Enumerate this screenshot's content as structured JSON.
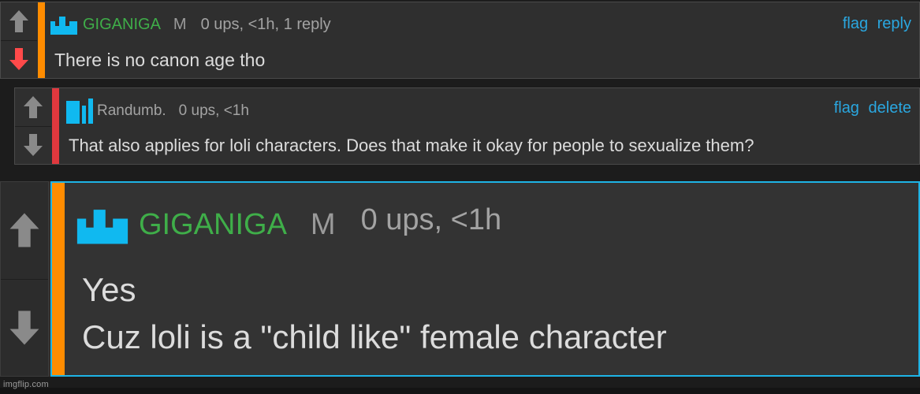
{
  "comments": [
    {
      "username": "GIGANIGA",
      "badge": "M",
      "meta": "0 ups, <1h, 1 reply",
      "actions": [
        "flag",
        "reply"
      ],
      "text": [
        "There is no canon age tho"
      ],
      "stripe_color": "#ff8c00",
      "downvote_active": true
    },
    {
      "username": "Randumb.",
      "badge": "",
      "meta": "0 ups, <1h",
      "actions": [
        "flag",
        "delete"
      ],
      "text": [
        "That also applies for loli characters. Does that make it okay for people to sexualize them?"
      ],
      "stripe_color": "#e0383e",
      "downvote_active": false
    },
    {
      "username": "GIGANIGA",
      "badge": "M",
      "meta": "0 ups, <1h",
      "actions": [],
      "text": [
        "Yes",
        "Cuz loli is a \"child like\" female character"
      ],
      "stripe_color": "#ff8c00",
      "downvote_active": false
    }
  ],
  "colors": {
    "username_green": "#3fae49",
    "link_blue": "#2aa7e0",
    "logo_blue": "#10b9f0",
    "downvote_red": "#ff4a4a",
    "vote_gray": "#8a8a8a",
    "highlight_border": "#1eb4e6"
  },
  "icons": [
    "upvote-arrow-icon",
    "downvote-arrow-icon",
    "imgflip-crown-icon",
    "user-logo-icon"
  ],
  "watermark": "imgflip.com"
}
